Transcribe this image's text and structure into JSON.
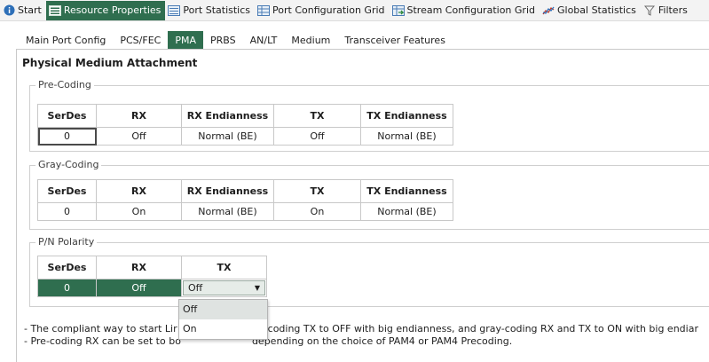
{
  "toolbar": {
    "tabs": [
      {
        "label": "Start",
        "icon": "info-icon",
        "active": false
      },
      {
        "label": "Resource Properties",
        "icon": "properties-icon",
        "active": true
      },
      {
        "label": "Port Statistics",
        "icon": "statistics-icon",
        "active": false
      },
      {
        "label": "Port Configuration Grid",
        "icon": "grid-icon",
        "active": false
      },
      {
        "label": "Stream Configuration Grid",
        "icon": "stream-grid-icon",
        "active": false
      },
      {
        "label": "Global Statistics",
        "icon": "chart-icon",
        "active": false
      },
      {
        "label": "Filters",
        "icon": "filter-icon",
        "active": false
      }
    ]
  },
  "subtabs": [
    {
      "label": "Main Port Config",
      "active": false
    },
    {
      "label": "PCS/FEC",
      "active": false
    },
    {
      "label": "PMA",
      "active": true
    },
    {
      "label": "PRBS",
      "active": false
    },
    {
      "label": "AN/LT",
      "active": false
    },
    {
      "label": "Medium",
      "active": false
    },
    {
      "label": "Transceiver Features",
      "active": false
    }
  ],
  "page_title": "Physical Medium Attachment",
  "precoding": {
    "label": "Pre-Coding",
    "headers": [
      "SerDes",
      "RX",
      "RX Endianness",
      "TX",
      "TX Endianness"
    ],
    "row": [
      "0",
      "Off",
      "Normal (BE)",
      "Off",
      "Normal (BE)"
    ]
  },
  "graycoding": {
    "label": "Gray-Coding",
    "headers": [
      "SerDes",
      "RX",
      "RX Endianness",
      "TX",
      "TX Endianness"
    ],
    "row": [
      "0",
      "On",
      "Normal (BE)",
      "On",
      "Normal (BE)"
    ]
  },
  "polarity": {
    "label": "P/N Polarity",
    "headers": [
      "SerDes",
      "RX",
      "TX"
    ],
    "row": [
      "0",
      "Off",
      "Off"
    ],
    "dropdown_options": [
      "Off",
      "On"
    ]
  },
  "notes": [
    "- The compliant way to start Lir",
    "pre-coding TX to OFF with big endianness, and gray-coding RX and TX to ON with big endiar",
    "- Pre-coding RX can be set to bo",
    "depending on the choice of PAM4 or PAM4 Precoding."
  ],
  "colors": {
    "accent": "#2f6e4f"
  }
}
